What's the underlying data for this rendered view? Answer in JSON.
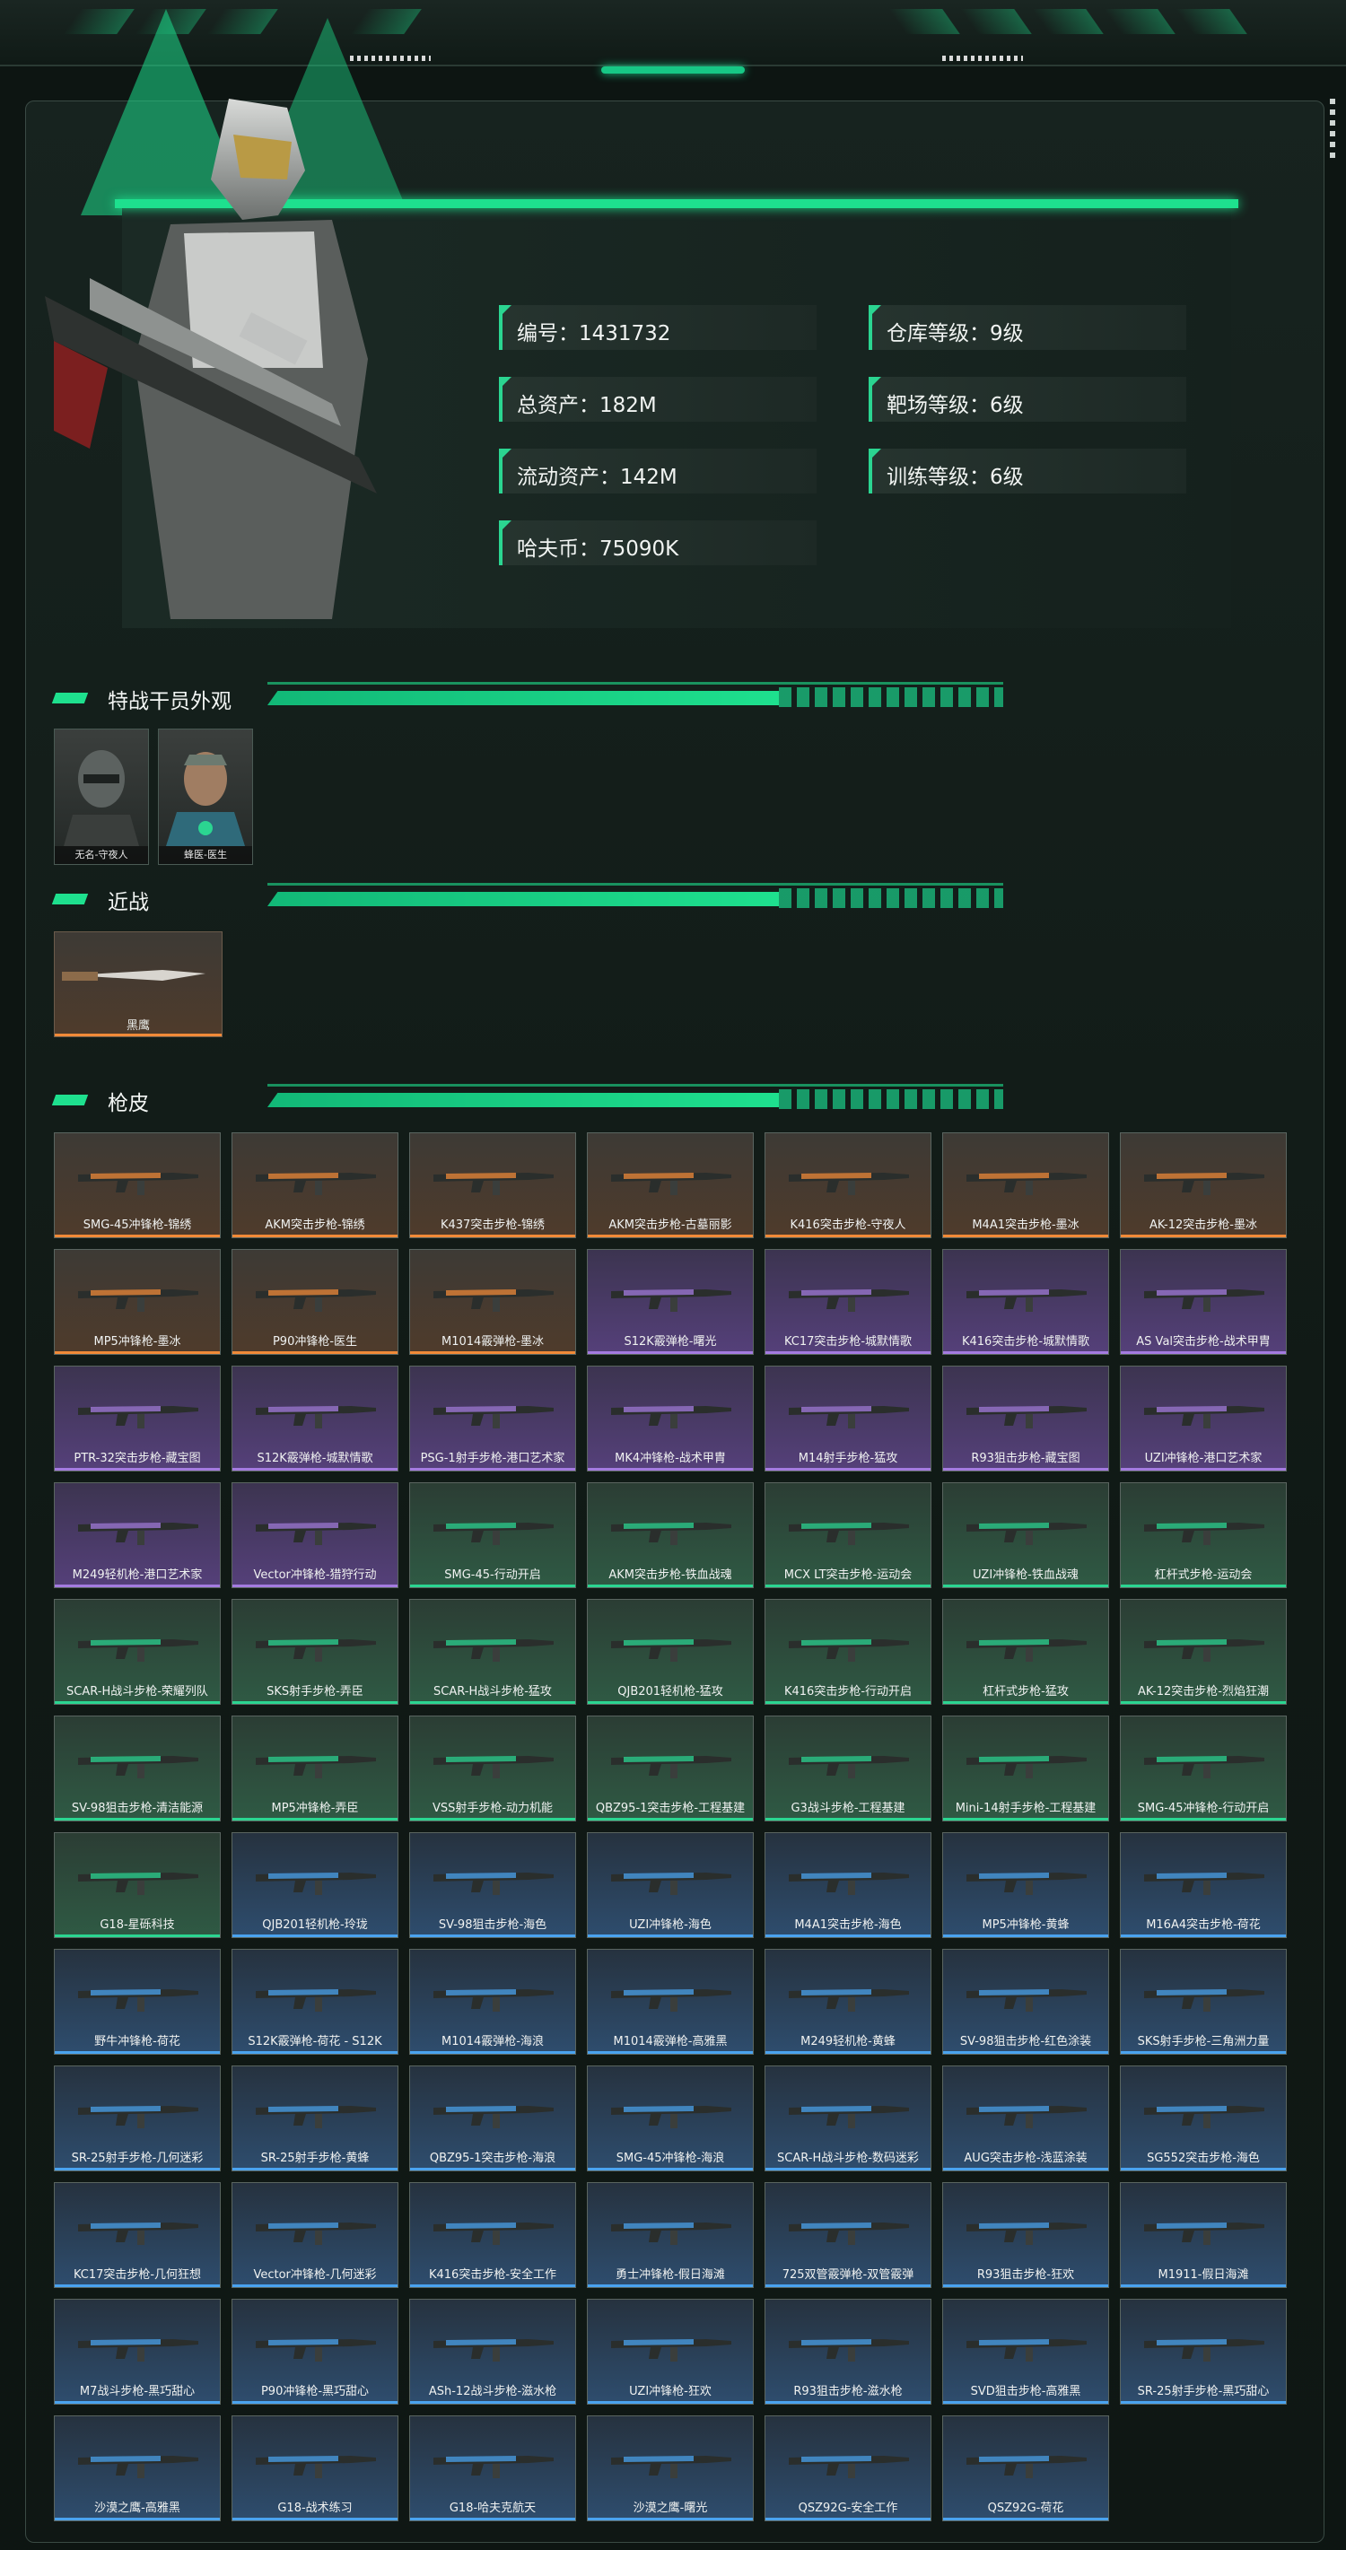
{
  "profile": {
    "stats": [
      {
        "label": "编号：1431732"
      },
      {
        "label": "仓库等级：9级"
      },
      {
        "label": "总资产：182M"
      },
      {
        "label": "靶场等级：6级"
      },
      {
        "label": "流动资产：142M"
      },
      {
        "label": "训练等级：6级"
      },
      {
        "label": "哈夫币：75090K"
      }
    ]
  },
  "sections": {
    "operators_title": "特战干员外观",
    "melee_title": "近战",
    "skins_title": "枪皮"
  },
  "operators": [
    {
      "name": "无名-守夜人"
    },
    {
      "name": "蜂医-医生"
    }
  ],
  "melee": [
    {
      "name": "黑鹰"
    }
  ],
  "skins": [
    {
      "name": "SMG-45冲锋枪-锦绣",
      "rarity": "orange"
    },
    {
      "name": "AKM突击步枪-锦绣",
      "rarity": "orange"
    },
    {
      "name": "K437突击步枪-锦绣",
      "rarity": "orange"
    },
    {
      "name": "AKM突击步枪-古墓丽影",
      "rarity": "orange"
    },
    {
      "name": "K416突击步枪-守夜人",
      "rarity": "orange"
    },
    {
      "name": "M4A1突击步枪-墨冰",
      "rarity": "orange"
    },
    {
      "name": "AK-12突击步枪-墨冰",
      "rarity": "orange"
    },
    {
      "name": "MP5冲锋枪-墨冰",
      "rarity": "orange"
    },
    {
      "name": "P90冲锋枪-医生",
      "rarity": "orange"
    },
    {
      "name": "M1014霰弹枪-墨冰",
      "rarity": "orange"
    },
    {
      "name": "S12K霰弹枪-曙光",
      "rarity": "purple"
    },
    {
      "name": "KC17突击步枪-城默情歌",
      "rarity": "purple"
    },
    {
      "name": "K416突击步枪-城默情歌",
      "rarity": "purple"
    },
    {
      "name": "AS Val突击步枪-战术甲胄",
      "rarity": "purple"
    },
    {
      "name": "PTR-32突击步枪-藏宝图",
      "rarity": "purple"
    },
    {
      "name": "S12K霰弹枪-城默情歌",
      "rarity": "purple"
    },
    {
      "name": "PSG-1射手步枪-港口艺术家",
      "rarity": "purple"
    },
    {
      "name": "MK4冲锋枪-战术甲胄",
      "rarity": "purple"
    },
    {
      "name": "M14射手步枪-猛攻",
      "rarity": "purple"
    },
    {
      "name": "R93狙击步枪-藏宝图",
      "rarity": "purple"
    },
    {
      "name": "UZI冲锋枪-港口艺术家",
      "rarity": "purple"
    },
    {
      "name": "M249轻机枪-港口艺术家",
      "rarity": "purple"
    },
    {
      "name": "Vector冲锋枪-猎狩行动",
      "rarity": "purple"
    },
    {
      "name": "SMG-45-行动开启",
      "rarity": "green"
    },
    {
      "name": "AKM突击步枪-铁血战魂",
      "rarity": "green"
    },
    {
      "name": "MCX LT突击步枪-运动会",
      "rarity": "green"
    },
    {
      "name": "UZI冲锋枪-铁血战魂",
      "rarity": "green"
    },
    {
      "name": "杠杆式步枪-运动会",
      "rarity": "green"
    },
    {
      "name": "SCAR-H战斗步枪-荣耀列队",
      "rarity": "green"
    },
    {
      "name": "SKS射手步枪-弄臣",
      "rarity": "green"
    },
    {
      "name": "SCAR-H战斗步枪-猛攻",
      "rarity": "green"
    },
    {
      "name": "QJB201轻机枪-猛攻",
      "rarity": "green"
    },
    {
      "name": "K416突击步枪-行动开启",
      "rarity": "green"
    },
    {
      "name": "杠杆式步枪-猛攻",
      "rarity": "green"
    },
    {
      "name": "AK-12突击步枪-烈焰狂潮",
      "rarity": "green"
    },
    {
      "name": "SV-98狙击步枪-清洁能源",
      "rarity": "green"
    },
    {
      "name": "MP5冲锋枪-弄臣",
      "rarity": "green"
    },
    {
      "name": "VSS射手步枪-动力机能",
      "rarity": "green"
    },
    {
      "name": "QBZ95-1突击步枪-工程基建",
      "rarity": "green"
    },
    {
      "name": "G3战斗步枪-工程基建",
      "rarity": "green"
    },
    {
      "name": "Mini-14射手步枪-工程基建",
      "rarity": "green"
    },
    {
      "name": "SMG-45冲锋枪-行动开启",
      "rarity": "green"
    },
    {
      "name": "G18-星砾科技",
      "rarity": "green"
    },
    {
      "name": "QJB201轻机枪-玲珑",
      "rarity": "blue"
    },
    {
      "name": "SV-98狙击步枪-海色",
      "rarity": "blue"
    },
    {
      "name": "UZI冲锋枪-海色",
      "rarity": "blue"
    },
    {
      "name": "M4A1突击步枪-海色",
      "rarity": "blue"
    },
    {
      "name": "MP5冲锋枪-黄蜂",
      "rarity": "blue"
    },
    {
      "name": "M16A4突击步枪-荷花",
      "rarity": "blue"
    },
    {
      "name": "野牛冲锋枪-荷花",
      "rarity": "blue"
    },
    {
      "name": "S12K霰弹枪-荷花 - S12K",
      "rarity": "blue"
    },
    {
      "name": "M1014霰弹枪-海浪",
      "rarity": "blue"
    },
    {
      "name": "M1014霰弹枪-高雅黑",
      "rarity": "blue"
    },
    {
      "name": "M249轻机枪-黄蜂",
      "rarity": "blue"
    },
    {
      "name": "SV-98狙击步枪-红色涂装",
      "rarity": "blue"
    },
    {
      "name": "SKS射手步枪-三角洲力量",
      "rarity": "blue"
    },
    {
      "name": "SR-25射手步枪-几何迷彩",
      "rarity": "blue"
    },
    {
      "name": "SR-25射手步枪-黄蜂",
      "rarity": "blue"
    },
    {
      "name": "QBZ95-1突击步枪-海浪",
      "rarity": "blue"
    },
    {
      "name": "SMG-45冲锋枪-海浪",
      "rarity": "blue"
    },
    {
      "name": "SCAR-H战斗步枪-数码迷彩",
      "rarity": "blue"
    },
    {
      "name": "AUG突击步枪-浅蓝涂装",
      "rarity": "blue"
    },
    {
      "name": "SG552突击步枪-海色",
      "rarity": "blue"
    },
    {
      "name": "KC17突击步枪-几何狂想",
      "rarity": "blue"
    },
    {
      "name": "Vector冲锋枪-几何迷彩",
      "rarity": "blue"
    },
    {
      "name": "K416突击步枪-安全工作",
      "rarity": "blue"
    },
    {
      "name": "勇士冲锋枪-假日海滩",
      "rarity": "blue"
    },
    {
      "name": "725双管霰弹枪-双管霰弹",
      "rarity": "blue"
    },
    {
      "name": "R93狙击步枪-狂欢",
      "rarity": "blue"
    },
    {
      "name": "M1911-假日海滩",
      "rarity": "blue"
    },
    {
      "name": "M7战斗步枪-黑巧甜心",
      "rarity": "blue"
    },
    {
      "name": "P90冲锋枪-黑巧甜心",
      "rarity": "blue"
    },
    {
      "name": "ASh-12战斗步枪-滋水枪",
      "rarity": "blue"
    },
    {
      "name": "UZI冲锋枪-狂欢",
      "rarity": "blue"
    },
    {
      "name": "R93狙击步枪-滋水枪",
      "rarity": "blue"
    },
    {
      "name": "SVD狙击步枪-高雅黑",
      "rarity": "blue"
    },
    {
      "name": "SR-25射手步枪-黑巧甜心",
      "rarity": "blue"
    },
    {
      "name": "沙漠之鹰-高雅黑",
      "rarity": "blue"
    },
    {
      "name": "G18-战术练习",
      "rarity": "blue"
    },
    {
      "name": "G18-哈夫克航天",
      "rarity": "blue"
    },
    {
      "name": "沙漠之鹰-曙光",
      "rarity": "blue"
    },
    {
      "name": "QSZ92G-安全工作",
      "rarity": "blue"
    },
    {
      "name": "QSZ92G-荷花",
      "rarity": "blue"
    }
  ],
  "colors": {
    "accent": "#1ee08e",
    "orange": "#f08a38",
    "purple": "#a47be0",
    "green": "#2bd591",
    "blue": "#4aa3ef"
  }
}
